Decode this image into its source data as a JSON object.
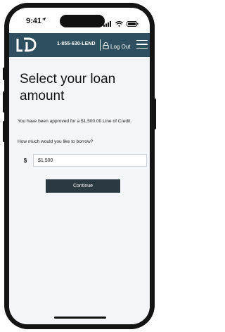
{
  "status_bar": {
    "time": "9:41",
    "location_icon": "location-arrow-icon",
    "signal_icon": "cellular-signal-icon",
    "wifi_icon": "wifi-icon",
    "battery_icon": "battery-icon"
  },
  "header": {
    "logo_text": "LD",
    "phone": "1-855-630-LEND",
    "logout_label": "Log Out",
    "logout_icon": "lock-icon",
    "menu_icon": "hamburger-menu-icon",
    "bg_color": "#2e4f5f"
  },
  "main": {
    "title": "Select your loan amount",
    "approved_text": "You have been approved for a $1,500.00 Line of Credit.",
    "question": "How much would you like to borrow?",
    "currency_symbol": "$",
    "amount_value": "$1,500",
    "continue_label": "Continue",
    "button_color": "#2b3943",
    "bg_color": "#f4f5f8"
  }
}
